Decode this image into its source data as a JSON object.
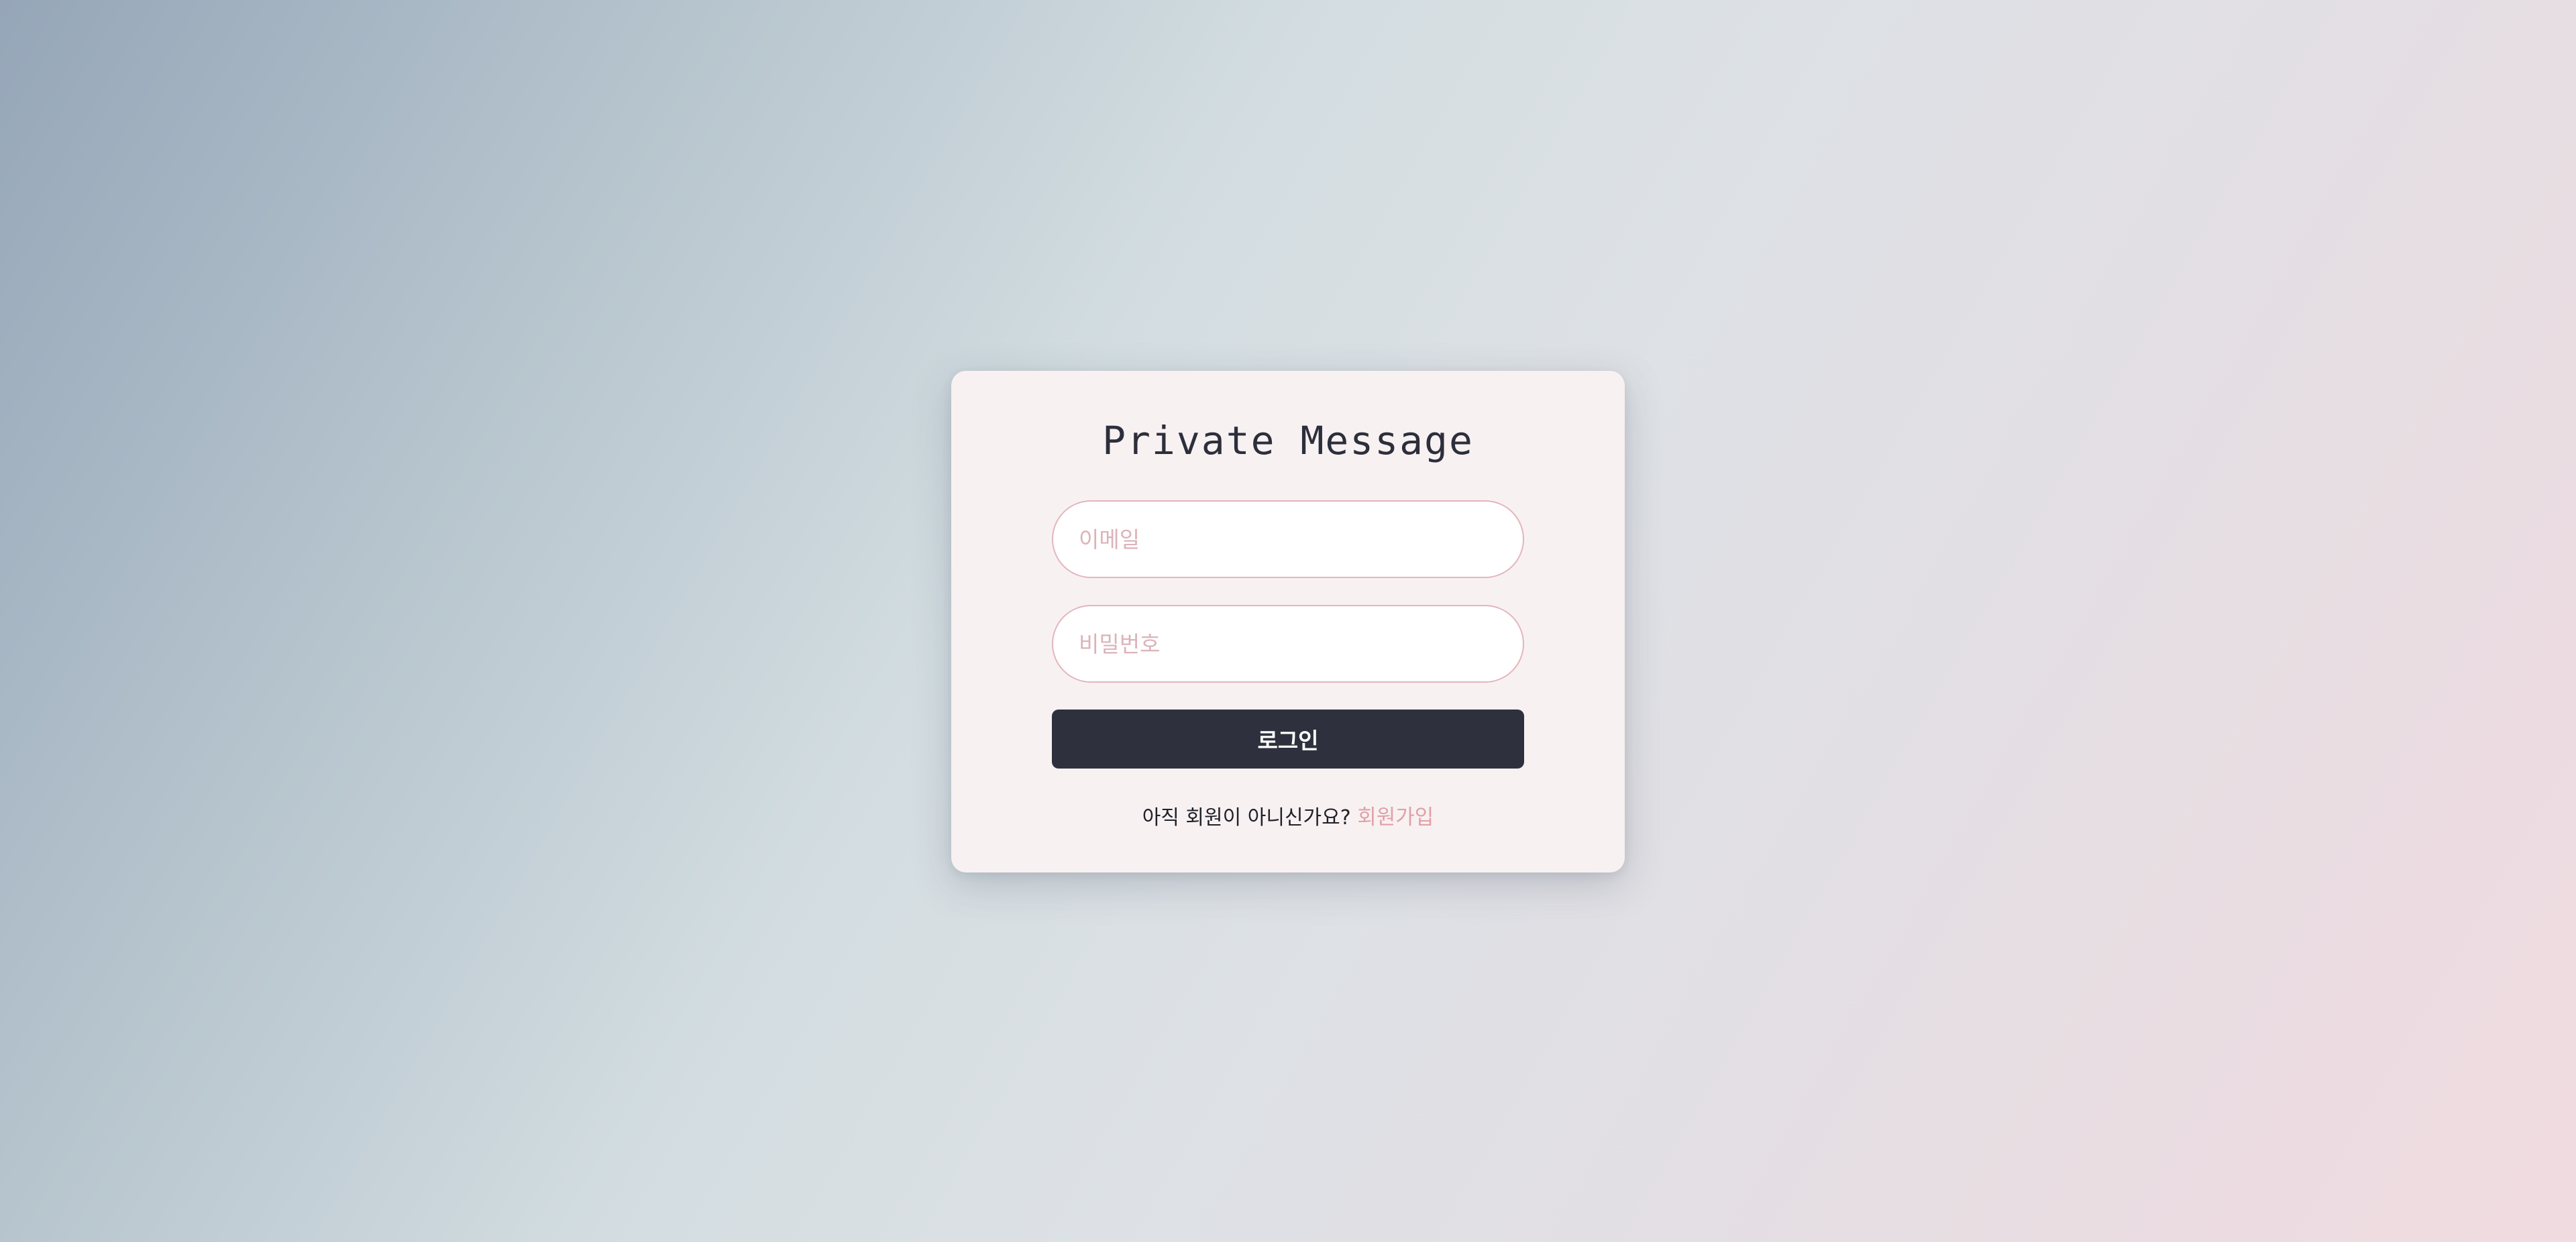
{
  "app": {
    "title": "Private Message"
  },
  "login_form": {
    "email_placeholder": "이메일",
    "email_value": "",
    "password_placeholder": "비밀번호",
    "password_value": "",
    "login_label": "로그인"
  },
  "signup": {
    "prompt": "아직 회원이 아니신가요?",
    "link_label": "회원가입"
  },
  "colors": {
    "card_background": "#f8f1f1",
    "button_background": "#2e313d",
    "input_border": "#e2b6bd",
    "placeholder": "#dcb3b9",
    "link": "#e0a0a8",
    "title_text": "#2c2f3b"
  }
}
